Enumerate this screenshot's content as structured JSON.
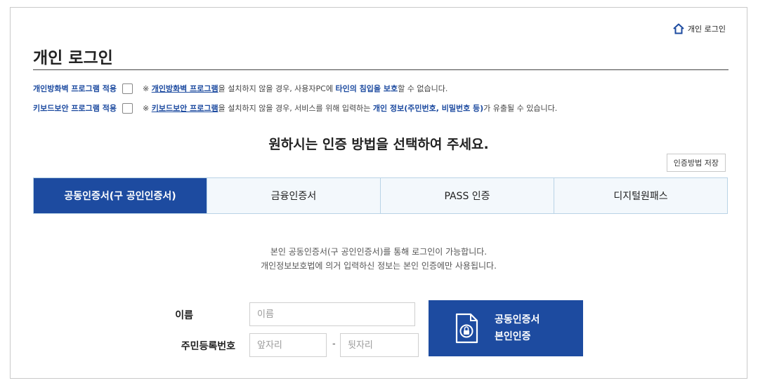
{
  "header": {
    "home_link": "개인 로그인",
    "home_icon": "home-icon",
    "title": "개인 로그인"
  },
  "options": {
    "firewall": {
      "label": "개인방화벽 프로그램 적용",
      "checked": false,
      "note_prefix": "※ ",
      "note_b1": "개인방화벽 프로그램",
      "note_mid": "을 설치하지 않을 경우, 사용자PC에 ",
      "note_b2": "타인의 침입을 보호",
      "note_end": "할 수 없습니다."
    },
    "keyboard": {
      "label": "키보드보안 프로그램 적용",
      "checked": false,
      "note_prefix": "※ ",
      "note_b1": "키보드보안 프로그램",
      "note_mid": "을 설치하지 않을 경우, 서비스를 위해 입력하는 ",
      "note_b2": "개인 정보(주민번호, 비밀번호 등)",
      "note_end": "가 유출될 수 있습니다."
    }
  },
  "main": {
    "headline": "원하시는 인증 방법을 선택하여 주세요.",
    "save_button": "인증방법 저장",
    "tabs": [
      {
        "label": "공동인증서(구 공인인증서)",
        "active": true
      },
      {
        "label": "금융인증서",
        "active": false
      },
      {
        "label": "PASS 인증",
        "active": false
      },
      {
        "label": "디지털원패스",
        "active": false
      }
    ],
    "description": [
      "본인 공동인증서(구 공인인증서)를 통해 로그인이 가능합니다.",
      "개인정보보호법에 의거 입력하신 정보는 본인 인증에만 사용됩니다."
    ]
  },
  "form": {
    "name_label": "이름",
    "name_placeholder": "이름",
    "rrn_label": "주민등록번호",
    "rrn_front_placeholder": "앞자리",
    "rrn_separator": "-",
    "rrn_back_placeholder": "뒷자리",
    "cert_button_line1": "공동인증서",
    "cert_button_line2": "본인인증",
    "cert_icon": "certificate-lock-icon"
  },
  "colors": {
    "primary": "#1d4ba0",
    "tab_bg": "#f3f8fc",
    "tab_border": "#b9d3e6"
  }
}
